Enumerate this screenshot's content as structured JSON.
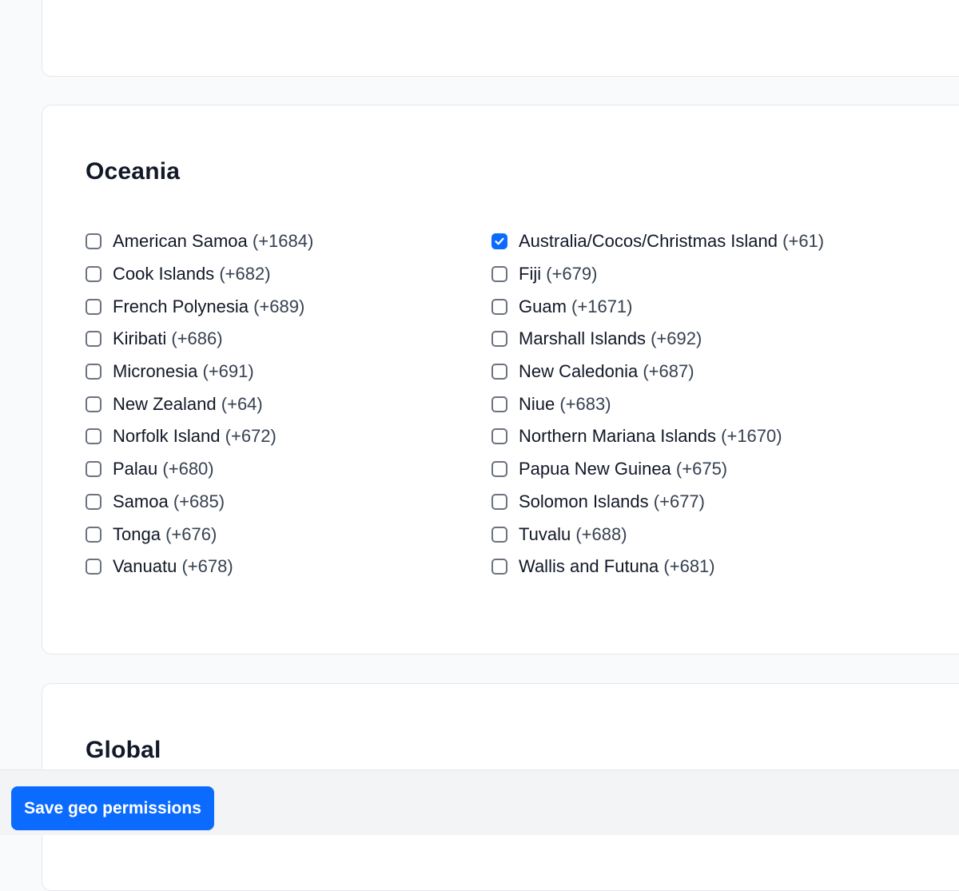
{
  "oceania": {
    "title": "Oceania",
    "left": [
      {
        "name": "American Samoa",
        "code": "(+1684)",
        "checked": false
      },
      {
        "name": "Cook Islands",
        "code": "(+682)",
        "checked": false
      },
      {
        "name": "French Polynesia",
        "code": "(+689)",
        "checked": false
      },
      {
        "name": "Kiribati",
        "code": "(+686)",
        "checked": false
      },
      {
        "name": "Micronesia",
        "code": "(+691)",
        "checked": false
      },
      {
        "name": "New Zealand",
        "code": "(+64)",
        "checked": false
      },
      {
        "name": "Norfolk Island",
        "code": "(+672)",
        "checked": false
      },
      {
        "name": "Palau",
        "code": "(+680)",
        "checked": false
      },
      {
        "name": "Samoa",
        "code": "(+685)",
        "checked": false
      },
      {
        "name": "Tonga",
        "code": "(+676)",
        "checked": false
      },
      {
        "name": "Vanuatu",
        "code": "(+678)",
        "checked": false
      }
    ],
    "right": [
      {
        "name": "Australia/Cocos/Christmas Island",
        "code": "(+61)",
        "checked": true
      },
      {
        "name": "Fiji",
        "code": "(+679)",
        "checked": false
      },
      {
        "name": "Guam",
        "code": "(+1671)",
        "checked": false
      },
      {
        "name": "Marshall Islands",
        "code": "(+692)",
        "checked": false
      },
      {
        "name": "New Caledonia",
        "code": "(+687)",
        "checked": false
      },
      {
        "name": "Niue",
        "code": "(+683)",
        "checked": false
      },
      {
        "name": "Northern Mariana Islands",
        "code": "(+1670)",
        "checked": false
      },
      {
        "name": "Papua New Guinea",
        "code": "(+675)",
        "checked": false
      },
      {
        "name": "Solomon Islands",
        "code": "(+677)",
        "checked": false
      },
      {
        "name": "Tuvalu",
        "code": "(+688)",
        "checked": false
      },
      {
        "name": "Wallis and Futuna",
        "code": "(+681)",
        "checked": false
      }
    ]
  },
  "global": {
    "title": "Global"
  },
  "footer": {
    "save_label": "Save geo permissions"
  },
  "colors": {
    "accent": "#0b6bff",
    "checkbox_border": "#6b7280",
    "card_border": "#e5e7eb",
    "footer_bg": "#f3f4f6"
  }
}
